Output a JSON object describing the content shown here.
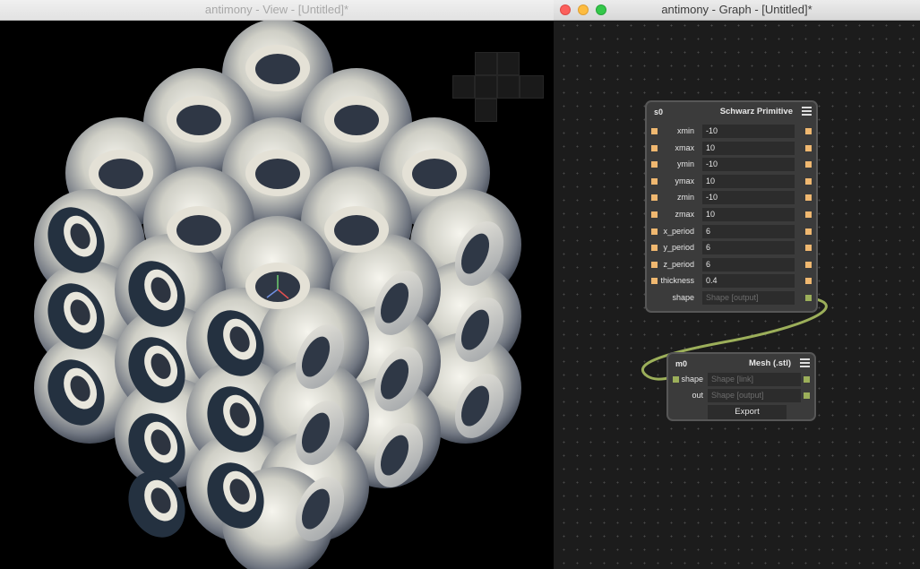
{
  "view_window": {
    "title": "antimony - View - [Untitled]*"
  },
  "graph_window": {
    "title": "antimony - Graph - [Untitled]*"
  },
  "nodes": {
    "schwarz": {
      "id": "s0",
      "type": "Schwarz Primitive",
      "params": [
        {
          "label": "xmin",
          "value": "-10"
        },
        {
          "label": "xmax",
          "value": "10"
        },
        {
          "label": "ymin",
          "value": "-10"
        },
        {
          "label": "ymax",
          "value": "10"
        },
        {
          "label": "zmin",
          "value": "-10"
        },
        {
          "label": "zmax",
          "value": "10"
        },
        {
          "label": "x_period",
          "value": "6"
        },
        {
          "label": "y_period",
          "value": "6"
        },
        {
          "label": "z_period",
          "value": "6"
        },
        {
          "label": "thickness",
          "value": "0.4"
        },
        {
          "label": "shape",
          "value": "Shape [output]"
        }
      ]
    },
    "mesh": {
      "id": "m0",
      "type": "Mesh (.stl)",
      "params": [
        {
          "label": "shape",
          "value": "Shape [link]"
        },
        {
          "label": "out",
          "value": "Shape [output]"
        }
      ],
      "export_label": "Export"
    }
  },
  "colors": {
    "float_port": "#f0b870",
    "shape_port": "#9caf5a",
    "wire": "#9caf5a"
  }
}
